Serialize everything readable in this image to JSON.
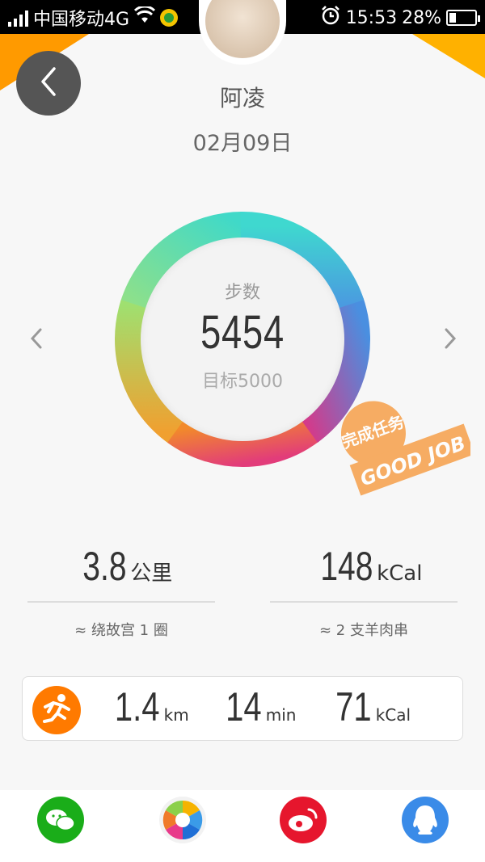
{
  "status_bar": {
    "carrier": "中国移动4G",
    "time": "15:53",
    "battery_percent": "28%",
    "battery_level": 0.28
  },
  "header": {
    "user_name": "阿凌",
    "date": "02月09日"
  },
  "ring": {
    "label": "步数",
    "steps": "5454",
    "goal": "目标5000",
    "progress": 1.0
  },
  "badge": {
    "top_text": "完成任务",
    "bottom_text": "GOOD JOB"
  },
  "stats": {
    "distance": {
      "value": "3.8",
      "unit": "公里",
      "note": "≈ 绕故宫 1 圈"
    },
    "calories": {
      "value": "148",
      "unit": "kCal",
      "note": "≈ 2 支羊肉串"
    }
  },
  "activity": {
    "distance": {
      "value": "1.4",
      "unit": "km"
    },
    "duration": {
      "value": "14",
      "unit": "min"
    },
    "calories": {
      "value": "71",
      "unit": "kCal"
    }
  },
  "share": {
    "wechat_color": "#1aad19",
    "moments_color": "#f2f2f2",
    "weibo_color": "#e6162d",
    "qq_color": "#3a8be8"
  },
  "colors": {
    "accent_orange": "#ff7a00"
  }
}
